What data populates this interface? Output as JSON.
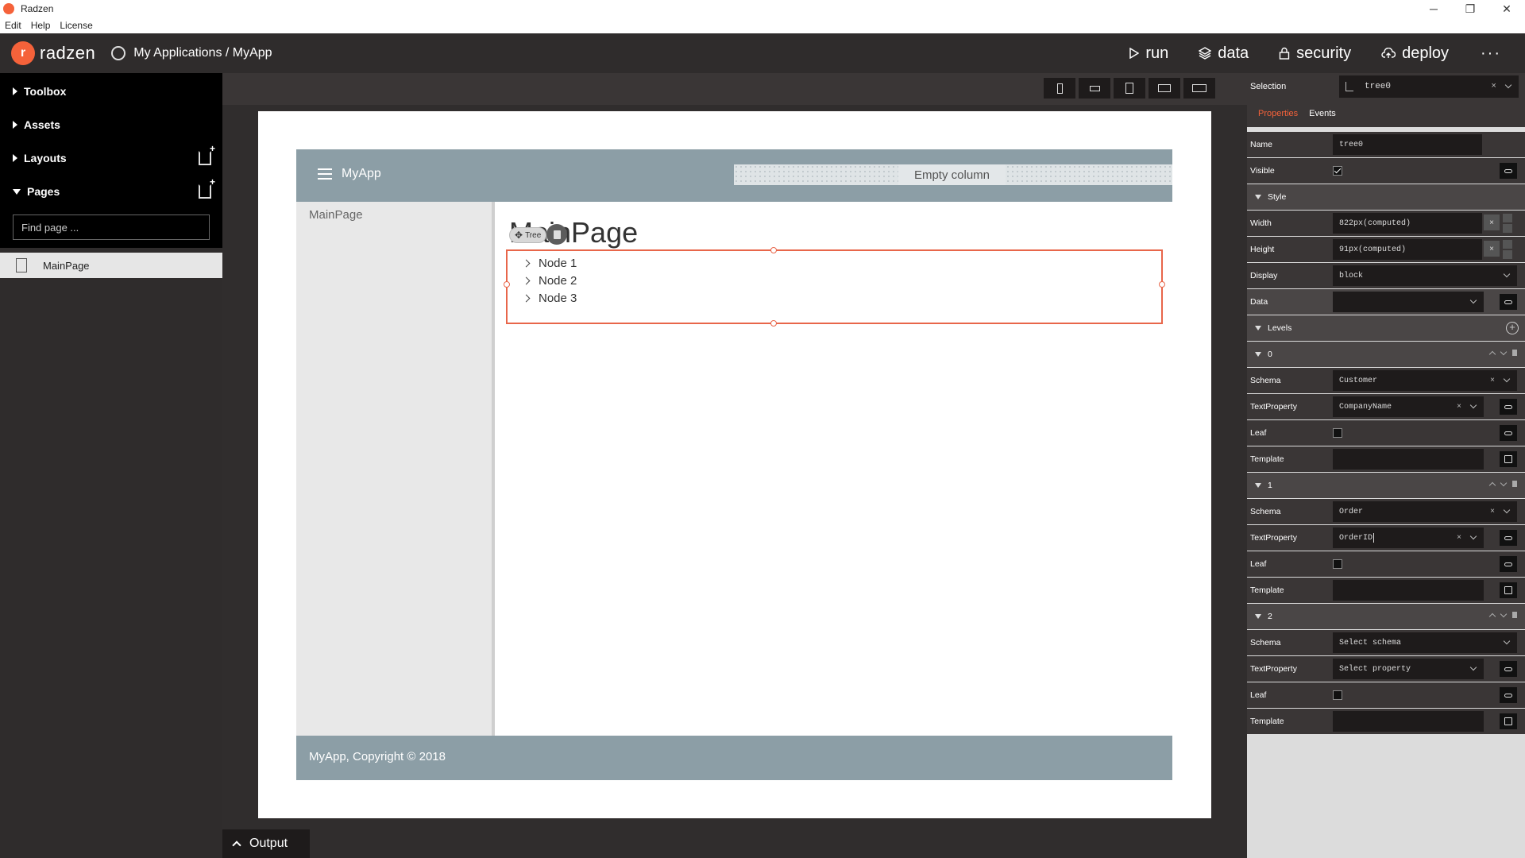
{
  "window": {
    "title": "Radzen",
    "controls": {
      "minimize": "─",
      "restore": "❐",
      "close": "✕"
    }
  },
  "menubar": {
    "items": [
      "Edit",
      "Help",
      "License"
    ]
  },
  "appbar": {
    "logo_text": "radzen",
    "breadcrumb": "My Applications / MyApp",
    "nav": [
      {
        "label": "run",
        "icon": "play-icon"
      },
      {
        "label": "data",
        "icon": "layers-icon"
      },
      {
        "label": "security",
        "icon": "lock-icon"
      },
      {
        "label": "deploy",
        "icon": "cloud-upload-icon"
      }
    ],
    "more": "···"
  },
  "sidebar": {
    "sections": [
      {
        "label": "Toolbox",
        "expanded": false
      },
      {
        "label": "Assets",
        "expanded": false
      },
      {
        "label": "Layouts",
        "expanded": false
      },
      {
        "label": "Pages",
        "expanded": true
      }
    ],
    "find_placeholder": "Find page ...",
    "pages": [
      "MainPage"
    ]
  },
  "canvas": {
    "device_buttons": [
      "phone-portrait",
      "phone-landscape",
      "tablet-portrait",
      "tablet-landscape",
      "desktop"
    ],
    "app_title": "MyApp",
    "empty_column": "Empty column",
    "side_link": "MainPage",
    "heading": "MainPage",
    "tree_chip": "Tree",
    "nodes": [
      "Node 1",
      "Node 2",
      "Node 3"
    ],
    "footer": "MyApp, Copyright © 2018",
    "output_tab": "Output"
  },
  "properties": {
    "selection_label": "Selection",
    "selection_value": "tree0",
    "tabs": [
      "Properties",
      "Events"
    ],
    "name_label": "Name",
    "name_value": "tree0",
    "visible_label": "Visible",
    "style_label": "Style",
    "width_label": "Width",
    "width_value": "822px(computed)",
    "height_label": "Height",
    "height_value": "91px(computed)",
    "display_label": "Display",
    "display_value": "block",
    "data_label": "Data",
    "levels_label": "Levels",
    "levels": [
      {
        "index": "0",
        "schema": "Customer",
        "text_property": "CompanyName"
      },
      {
        "index": "1",
        "schema": "Order",
        "text_property": "OrderID"
      },
      {
        "index": "2",
        "schema": "Select schema",
        "text_property": "Select property"
      }
    ],
    "schema_label": "Schema",
    "text_property_label": "TextProperty",
    "leaf_label": "Leaf",
    "template_label": "Template",
    "accent_color": "#f5623a"
  }
}
